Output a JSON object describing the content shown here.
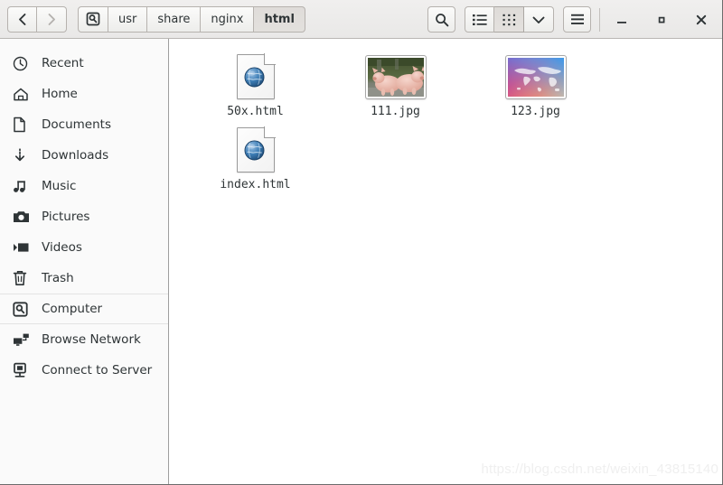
{
  "window": {
    "nav": {
      "back_label": "‹",
      "back_icon": "chevron-left-icon",
      "forward_label": "›",
      "forward_icon": "chevron-right-icon"
    },
    "breadcrumb": {
      "root_icon": "computer-icon",
      "items": [
        {
          "label": "usr",
          "current": false
        },
        {
          "label": "share",
          "current": false
        },
        {
          "label": "nginx",
          "current": false
        },
        {
          "label": "html",
          "current": true
        }
      ]
    },
    "toolbar": {
      "search_icon": "search-icon",
      "list_view_icon": "list-view-icon",
      "grid_view_icon": "grid-view-icon",
      "sort_icon": "chevron-down-icon",
      "menu_icon": "hamburger-menu-icon",
      "active_view": "grid-view-icon"
    },
    "controls": {
      "minimize_icon": "minimize-icon",
      "maximize_icon": "maximize-icon",
      "close_icon": "close-icon"
    }
  },
  "sidebar": {
    "items": [
      {
        "label": "Recent",
        "icon": "clock-icon",
        "selected": false
      },
      {
        "label": "Home",
        "icon": "home-icon",
        "selected": false
      },
      {
        "label": "Documents",
        "icon": "document-icon",
        "selected": false
      },
      {
        "label": "Downloads",
        "icon": "download-icon",
        "selected": false
      },
      {
        "label": "Music",
        "icon": "music-note-icon",
        "selected": false
      },
      {
        "label": "Pictures",
        "icon": "camera-icon",
        "selected": false
      },
      {
        "label": "Videos",
        "icon": "video-icon",
        "selected": false
      },
      {
        "label": "Trash",
        "icon": "trash-icon",
        "selected": false
      },
      {
        "label": "Computer",
        "icon": "computer-icon",
        "selected": true
      },
      {
        "label": "Browse Network",
        "icon": "network-icon",
        "selected": false
      },
      {
        "label": "Connect to Server",
        "icon": "server-icon",
        "selected": false
      }
    ]
  },
  "content": {
    "files": [
      {
        "name": "50x.html",
        "kind": "html-document",
        "icon": "html-file-icon"
      },
      {
        "name": "111.jpg",
        "kind": "image",
        "icon": "photo-thumbnail-pigs"
      },
      {
        "name": "123.jpg",
        "kind": "image",
        "icon": "photo-thumbnail-worldmap"
      },
      {
        "name": "index.html",
        "kind": "html-document",
        "icon": "html-file-icon"
      }
    ],
    "watermark": "https://blog.csdn.net/weixin_43815140"
  },
  "colors": {
    "header_bg": "#ededeb",
    "sidebar_bg": "#fafafa",
    "content_bg": "#ffffff",
    "text": "#2e3436",
    "border": "#b6b2ae",
    "globe_blue": "#2f6ca8",
    "watermark_text": "#efefef"
  }
}
